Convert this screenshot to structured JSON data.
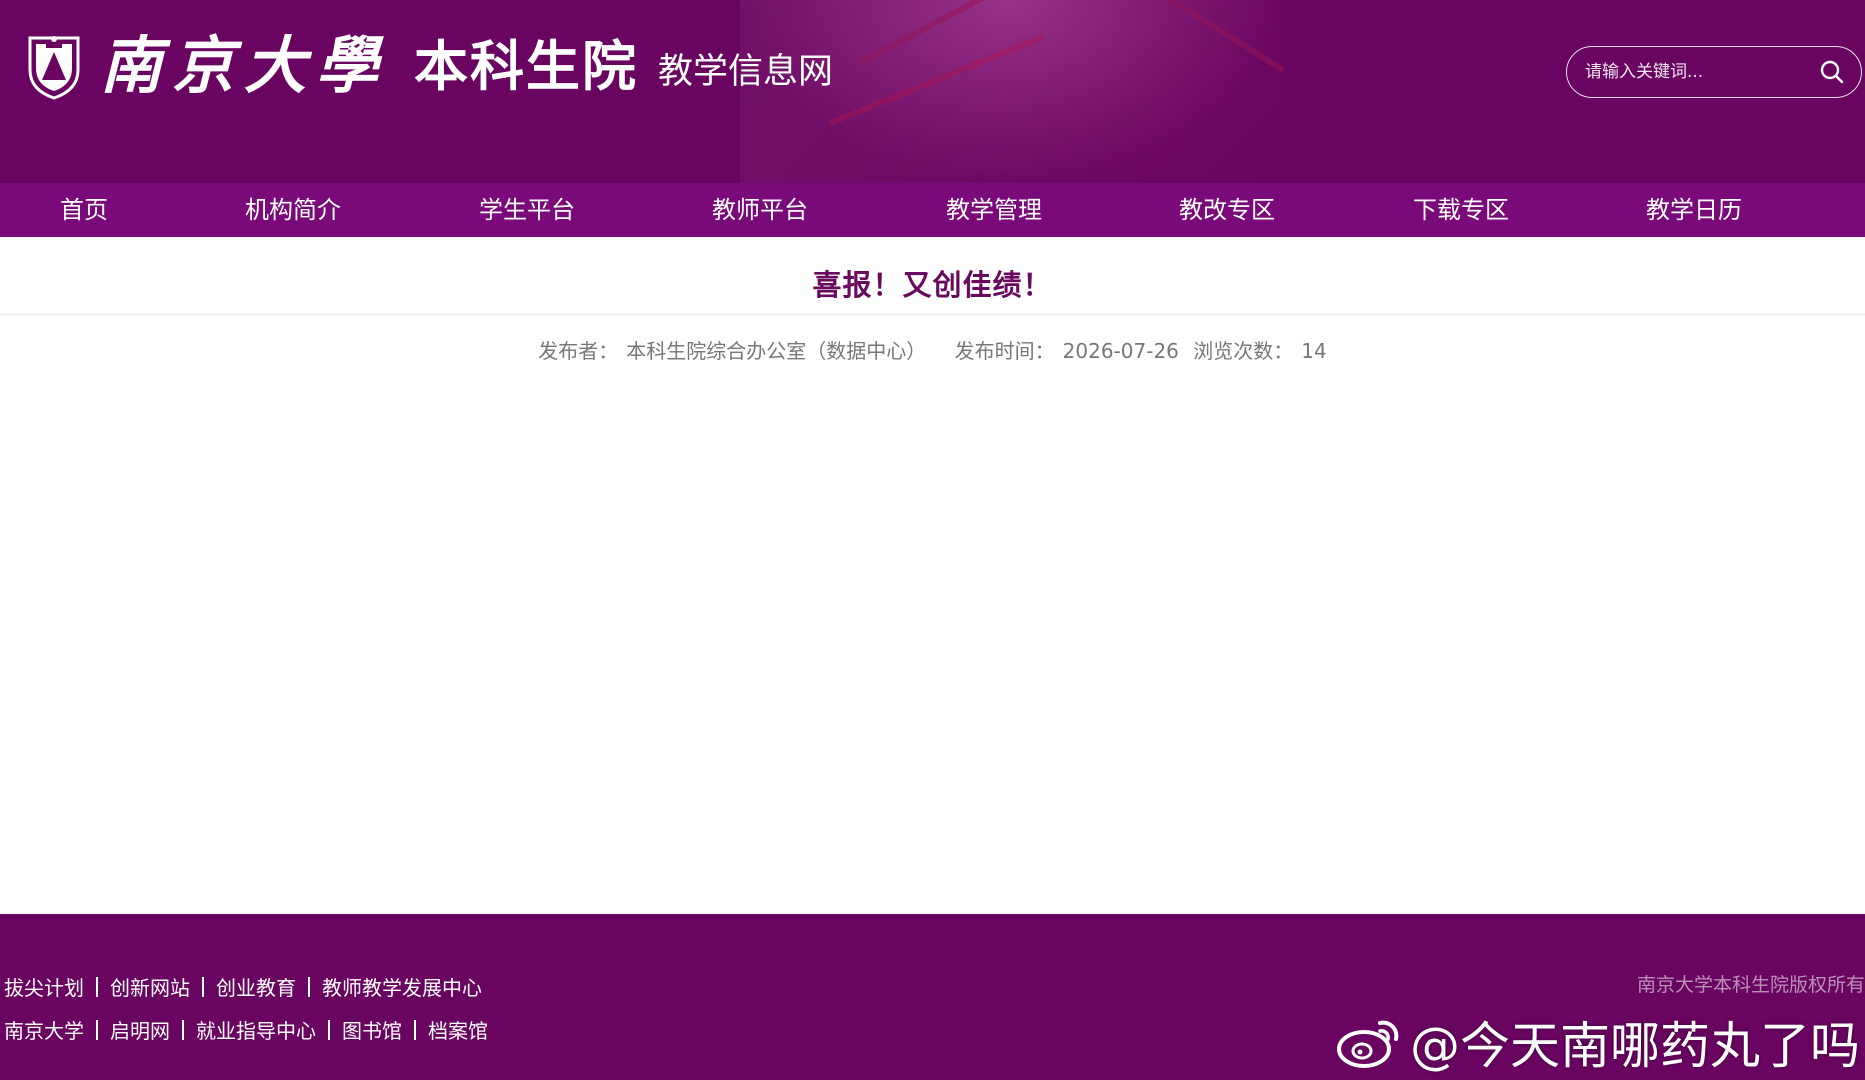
{
  "header": {
    "university_name": "南京大學",
    "college_name": "本科生院",
    "site_name": "教学信息网",
    "search_placeholder": "请输入关键词...",
    "emblem_icon": "university-emblem-icon",
    "search_icon": "search-icon"
  },
  "nav": {
    "items": [
      {
        "label": "首页"
      },
      {
        "label": "机构简介"
      },
      {
        "label": "学生平台"
      },
      {
        "label": "教师平台"
      },
      {
        "label": "教学管理"
      },
      {
        "label": "教改专区"
      },
      {
        "label": "下载专区"
      },
      {
        "label": "教学日历"
      }
    ]
  },
  "article": {
    "title": "喜报！又创佳绩！",
    "publisher_label": "发布者：",
    "publisher": "本科生院综合办公室（数据中心）",
    "time_label": "发布时间：",
    "time": "2026-07-26",
    "views_label": "浏览次数：",
    "views": "14"
  },
  "footer": {
    "links_row1": [
      "拔尖计划",
      "创新网站",
      "创业教育",
      "教师教学发展中心"
    ],
    "links_row2": [
      "南京大学",
      "启明网",
      "就业指导中心",
      "图书馆",
      "档案馆"
    ],
    "copyright": "南京大学本科生院版权所有",
    "watermark": "@今天南哪药丸了吗",
    "watermark_icon": "weibo-icon"
  },
  "colors": {
    "primary": "#6a0461",
    "nav": "#7a0a79",
    "title": "#6a0a5f",
    "meta_text": "#777777"
  }
}
